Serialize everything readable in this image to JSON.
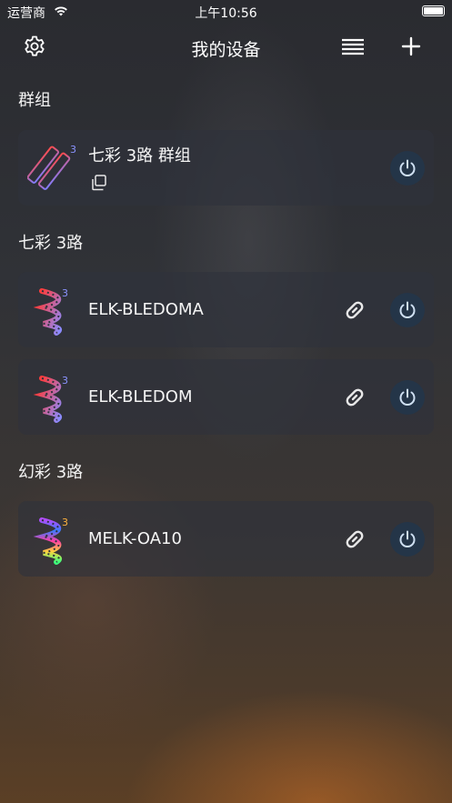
{
  "status_bar": {
    "carrier": "运营商",
    "time": "上午10:56"
  },
  "nav": {
    "title": "我的设备",
    "left_icon": "gear-icon",
    "right_icons": [
      "list-icon",
      "plus-icon"
    ]
  },
  "sections": [
    {
      "title": "群组",
      "items": [
        {
          "name": "七彩 3路 群组",
          "thumb_icon": "led-strip-group-icon",
          "badge": "3"
        }
      ]
    },
    {
      "title": "七彩 3路",
      "items": [
        {
          "name": "ELK-BLEDOMA",
          "thumb_icon": "led-strip-icon",
          "badge": "3"
        },
        {
          "name": "ELK-BLEDOM",
          "thumb_icon": "led-strip-icon",
          "badge": "3"
        }
      ]
    },
    {
      "title": "幻彩 3路",
      "items": [
        {
          "name": "MELK-OA10",
          "thumb_icon": "rainbow-strip-icon",
          "badge": "3"
        }
      ]
    }
  ],
  "colors": {
    "card_bg": "#2e323c",
    "power_button_bg": "#243548",
    "power_icon": "#cfe0f2"
  }
}
